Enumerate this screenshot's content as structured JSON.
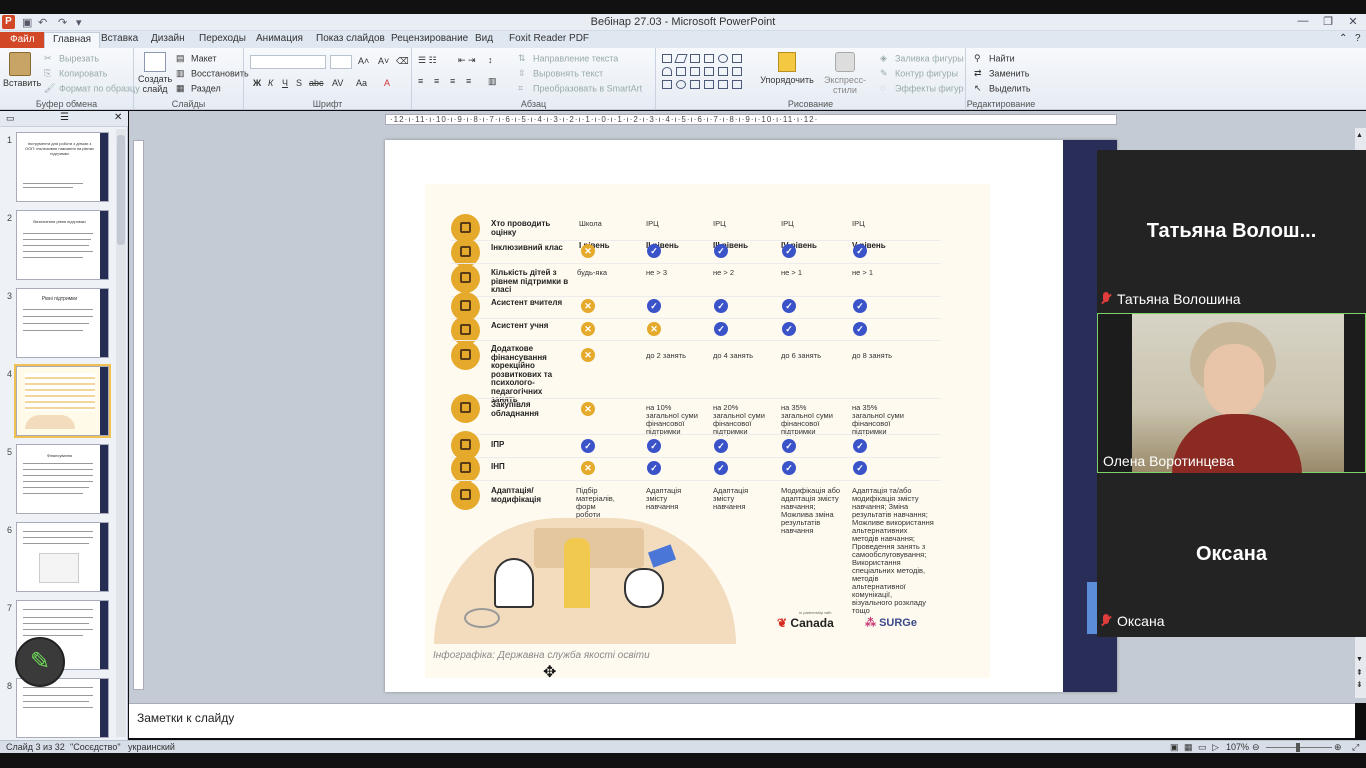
{
  "window": {
    "title": "Вебінар 27.03 - Microsoft PowerPoint",
    "app_letter": "P"
  },
  "tabs": [
    "Файл",
    "Главная",
    "Вставка",
    "Дизайн",
    "Переходы",
    "Анимация",
    "Показ слайдов",
    "Рецензирование",
    "Вид",
    "Foxit Reader PDF"
  ],
  "ribbon": {
    "clipboard": {
      "paste": "Вставить",
      "cut": "Вырезать",
      "copy": "Копировать",
      "format": "Формат по образцу",
      "label": "Буфер обмена"
    },
    "slides": {
      "new": "Создать слайд",
      "layout": "Макет",
      "reset": "Восстановить",
      "section": "Раздел",
      "label": "Слайды"
    },
    "font": {
      "label": "Шрифт"
    },
    "paragraph": {
      "direction": "Направление текста",
      "align": "Выровнять текст",
      "smartart": "Преобразовать в SmartArt",
      "label": "Абзац"
    },
    "drawing": {
      "arrange": "Упорядочить",
      "styles": "Экспресс-стили",
      "fill": "Заливка фигуры",
      "outline": "Контур фигуры",
      "effects": "Эффекты фигур",
      "label": "Рисование"
    },
    "editing": {
      "find": "Найти",
      "replace": "Заменить",
      "select": "Выделить",
      "label": "Редактирование"
    }
  },
  "ruler_text": "·12·ı·11·ı·10·ı·9·ı·8·ı·7·ı·6·ı·5·ı·4·ı·3·ı·2·ı·1·ı·0·ı·1·ı·2·ı·3·ı·4·ı·5·ı·6·ı·7·ı·8·ı·9·ı·10·ı·11·ı·12·",
  "thumbs": [
    {
      "num": "1",
      "title": "Інструменти для роботи з дітьми з ООП: інклюзивне навчання на рівнях підтримки"
    },
    {
      "num": "2",
      "title": "Визначення рівня підтримки"
    },
    {
      "num": "3",
      "title": "Рівні підтримки"
    },
    {
      "num": "4",
      "title": ""
    },
    {
      "num": "5",
      "title": "Фінансування"
    },
    {
      "num": "6",
      "title": ""
    },
    {
      "num": "7",
      "title": ""
    },
    {
      "num": "8",
      "title": ""
    }
  ],
  "slide": {
    "headers": [
      "I рівень",
      "II рівень",
      "III рівень",
      "IV рівень",
      "V рівень"
    ],
    "rows": {
      "who": {
        "label": "Хто проводить оцінку",
        "c1": "Школа",
        "c2": "ІРЦ",
        "c3": "ІРЦ",
        "c4": "ІРЦ",
        "c5": "ІРЦ"
      },
      "class": {
        "label": "Інклюзивний клас"
      },
      "kids": {
        "label": "Кількість дітей з рівнем підтримки в класі",
        "c1": "будь-яка",
        "c2": "не > 3",
        "c3": "не > 2",
        "c4": "не > 1",
        "c5": "не > 1"
      },
      "teacher_asst": {
        "label": "Асистент вчителя"
      },
      "student_asst": {
        "label": "Асистент учня"
      },
      "funding": {
        "label": "Додаткове фінансування корекційно розвиткових та психолого-педагогічних занять",
        "c2": "до 2 занять",
        "c3": "до 4 занять",
        "c4": "до 6 занять",
        "c5": "до 8 занять"
      },
      "equip": {
        "label": "Закупівля обладнання",
        "c2": "на 10% загальної суми фінансової підтримки",
        "c3": "на 20% загальної суми фінансової підтримки",
        "c4": "на 35% загальної суми фінансової підтримки",
        "c5": "на 35% загальної суми фінансової підтримки"
      },
      "ipr": {
        "label": "ІПР"
      },
      "inp": {
        "label": "ІНП"
      },
      "adapt": {
        "label": "Адаптація/ модифікація",
        "c1": "Підбір матеріалів, форм роботи",
        "c2": "Адаптація змісту навчання",
        "c3": "Адаптація змісту навчання",
        "c4": "Модифікація або адаптація змісту навчання; Можлива зміна результатів навчання",
        "c5": "Адаптація та/або модифікація змісту навчання; Зміна результатів навчання; Можливе використання альтернативних методів навчання; Проведення занять з самообслуговування; Використання спеціальних методів, методів альтернативної комунікації, візуального розкладу тощо"
      }
    },
    "credit": "Інфографіка: Державна служба якості освіти",
    "logo_canada": "Canada",
    "logo_partner": "in partnership with",
    "logo_surge": "SURGe"
  },
  "notes_placeholder": "Заметки к слайду",
  "status": {
    "slide": "Слайд 3 из 32",
    "theme": "\"Сосєдство\"",
    "lang": "украинский",
    "zoom": "107%"
  },
  "video": {
    "tile1_big": "Татьяна  Волош...",
    "tile1_name": "Татьяна Волошина",
    "tile2_name": "Олена Воротинцева",
    "tile3_big": "Оксана",
    "tile3_name": "Оксана"
  },
  "colors": {
    "accent": "#d24726",
    "icon_amber": "#e5aa2c",
    "check_blue": "#3a53c8",
    "slide_navy": "#282e57"
  }
}
